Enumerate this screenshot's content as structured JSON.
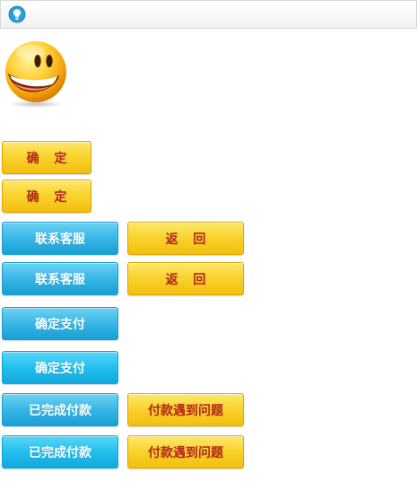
{
  "tip_icon": "lightbulb-icon",
  "smiley_icon": "smiley-face-icon",
  "buttons": {
    "confirm_1": "确 定",
    "confirm_2": "确 定",
    "contact_1": "联系客服",
    "back_1": "返 回",
    "contact_2": "联系客服",
    "back_2": "返 回",
    "pay_confirm_1": "确定支付",
    "pay_confirm_2": "确定支付",
    "paid_1": "已完成付款",
    "problem_1": "付款遇到问题",
    "paid_2": "已完成付款",
    "problem_2": "付款遇到问题"
  },
  "colors": {
    "yellow_text": "#b3241b",
    "yellow_top": "#fde86a",
    "yellow_bottom": "#f2bd07",
    "blue_top": "#6ed2f3",
    "blue_bottom": "#199fd5",
    "tip_icon_color": "#1a8fc9"
  }
}
